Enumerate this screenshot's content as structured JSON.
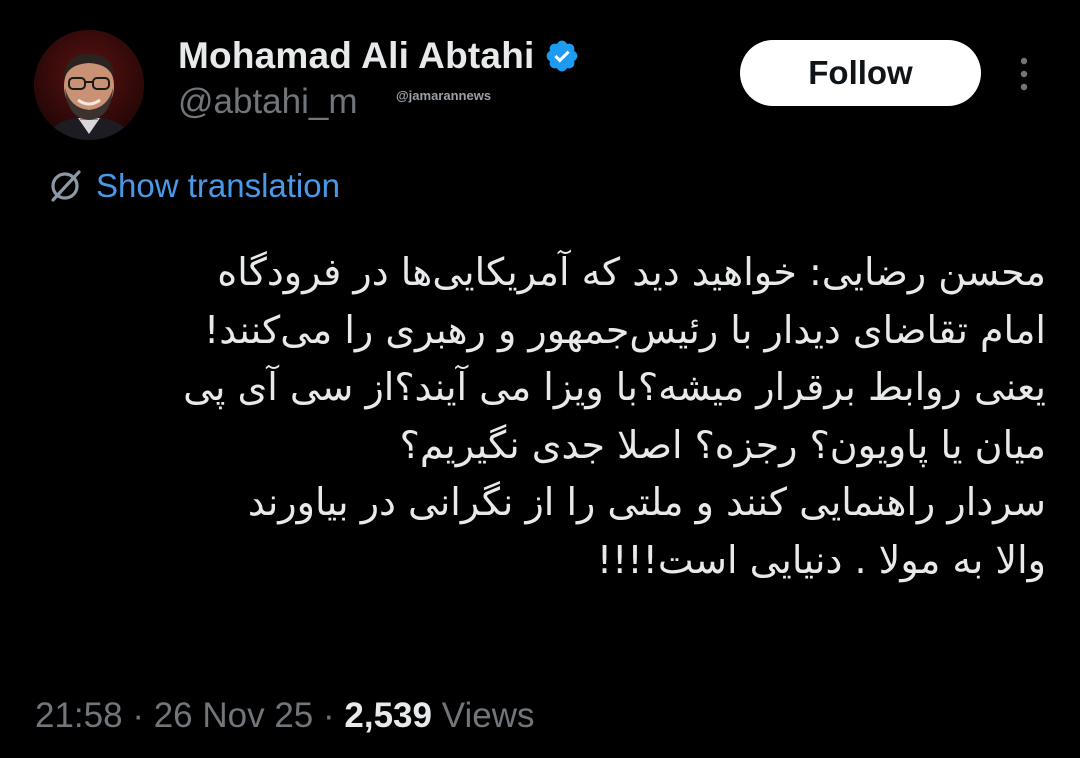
{
  "author": {
    "display_name": "Mohamad Ali Abtahi",
    "handle": "@abtahi_m",
    "verified_color": "#1d9bf0"
  },
  "watermark": "@jamarannews",
  "actions": {
    "follow_label": "Follow",
    "more_icon": "more-vertical-icon"
  },
  "translation": {
    "label": "Show translation",
    "icon": "globe-icon",
    "color": "#4a99e9"
  },
  "tweet": {
    "lines": [
      "محسن رضایی: خواهید دید که آمریکایی‌ها در فرودگاه",
      "امام تقاضای دیدار با رئیس‌جمهور و رهبری را می‌کنند!",
      "یعنی روابط برقرار میشه؟با ویزا می آیند؟از سی آی پی",
      "میان یا پاویون؟ رجزه؟ اصلا جدی نگیریم؟",
      "سردار راهنمایی کنند و ملتی را از نگرانی در بیاورند",
      "والا به مولا . دنیایی است!!!!"
    ]
  },
  "meta": {
    "time": "21:58",
    "separator": "·",
    "date": "26 Nov 25",
    "views_count": "2,539",
    "views_label": "Views"
  },
  "colors": {
    "background": "#000000",
    "primary_text": "#e7e9ea",
    "secondary_text": "#71767b",
    "follow_bg": "#ffffff"
  }
}
